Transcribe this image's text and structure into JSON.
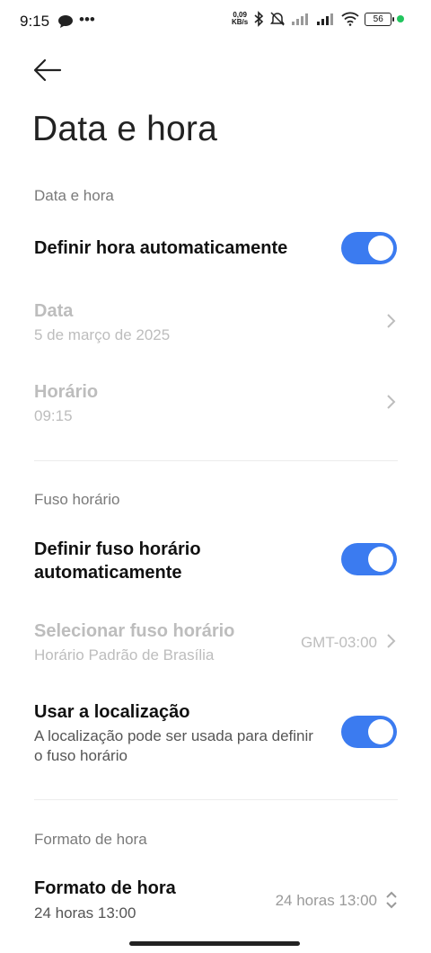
{
  "status_bar": {
    "time": "9:15",
    "net_speed_value": "0,09",
    "net_speed_unit": "KB/s",
    "battery": "56",
    "icons": [
      "chat-bubble-icon",
      "more-icon",
      "bluetooth-icon",
      "mute-icon",
      "signal-icon",
      "signal-icon",
      "wifi-icon",
      "battery-icon"
    ]
  },
  "header": {
    "back_icon": "arrow-left-icon",
    "title": "Data e hora"
  },
  "sections": {
    "date_time": {
      "label": "Data e hora",
      "auto_time": {
        "title": "Definir hora automaticamente",
        "enabled": true
      },
      "date": {
        "title": "Data",
        "value": "5 de março de 2025"
      },
      "time": {
        "title": "Horário",
        "value": "09:15"
      }
    },
    "timezone": {
      "label": "Fuso horário",
      "auto_tz": {
        "title_line1": "Definir fuso horário",
        "title_line2": "automaticamente",
        "enabled": true
      },
      "select_tz": {
        "title": "Selecionar fuso horário",
        "subtitle": "Horário Padrão de Brasília",
        "value": "GMT-03:00"
      },
      "use_location": {
        "title": "Usar a localização",
        "subtitle_line1": "A localização pode ser usada para definir",
        "subtitle_line2": "o fuso horário",
        "enabled": true
      }
    },
    "time_format": {
      "label": "Formato de hora",
      "format": {
        "title": "Formato de hora",
        "subtitle": "24 horas 13:00",
        "value": "24 horas 13:00"
      }
    }
  },
  "colors": {
    "accent": "#3b7bf0",
    "disabled_text": "#bdbdbd",
    "section_label": "#7a7a7a"
  }
}
